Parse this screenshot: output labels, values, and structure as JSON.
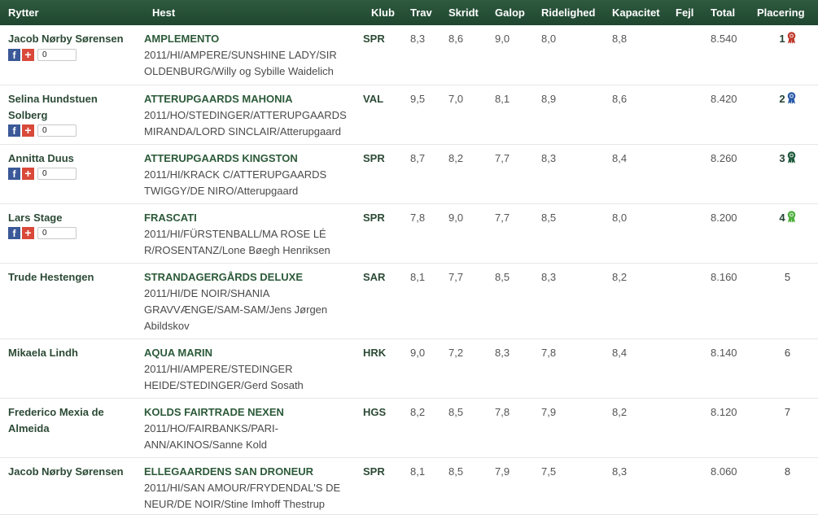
{
  "headers": {
    "rider": "Rytter",
    "horse": "Hest",
    "club": "Klub",
    "trav": "Trav",
    "skridt": "Skridt",
    "galop": "Galop",
    "ridelighed": "Ridelighed",
    "kapacitet": "Kapacitet",
    "fejl": "Fejl",
    "total": "Total",
    "placering": "Placering"
  },
  "rows": [
    {
      "rider": "Jacob Nørby Sørensen",
      "horse": "AMPLEMENTO",
      "info": "2011/HI/AMPERE/SUNSHINE LADY/SIR OLDENBURG/Willy og Sybille Waidelich",
      "club": "SPR",
      "trav": "8,3",
      "skridt": "8,6",
      "galop": "9,0",
      "ridelighed": "8,0",
      "kapacitet": "8,8",
      "fejl": "",
      "total": "8.540",
      "place": "1",
      "rosette_color": "#c0392b",
      "social": true,
      "share_count": "0",
      "rosette_icon": "rosette-red-icon"
    },
    {
      "rider": "Selina Hundstuen Solberg",
      "horse": "ATTERUPGAARDS MAHONIA",
      "info": "2011/HO/STEDINGER/ATTERUPGAARDS MIRANDA/LORD SINCLAIR/Atterupgaard",
      "club": "VAL",
      "trav": "9,5",
      "skridt": "7,0",
      "galop": "8,1",
      "ridelighed": "8,9",
      "kapacitet": "8,6",
      "fejl": "",
      "total": "8.420",
      "place": "2",
      "rosette_color": "#2a5aa8",
      "social": true,
      "share_count": "0",
      "rosette_icon": "rosette-blue-icon"
    },
    {
      "rider": "Annitta Duus",
      "horse": "ATTERUPGAARDS KINGSTON",
      "info": "2011/HI/KRACK C/ATTERUPGAARDS TWIGGY/DE NIRO/Atterupgaard",
      "club": "SPR",
      "trav": "8,7",
      "skridt": "8,2",
      "galop": "7,7",
      "ridelighed": "8,3",
      "kapacitet": "8,4",
      "fejl": "",
      "total": "8.260",
      "place": "3",
      "rosette_color": "#1f5a3c",
      "social": true,
      "share_count": "0",
      "rosette_icon": "rosette-darkgreen-icon"
    },
    {
      "rider": "Lars Stage",
      "horse": "FRASCATI",
      "info": "2011/HI/FÜRSTENBALL/MA ROSE LÉ R/ROSENTANZ/Lone Bøegh Henriksen",
      "club": "SPR",
      "trav": "7,8",
      "skridt": "9,0",
      "galop": "7,7",
      "ridelighed": "8,5",
      "kapacitet": "8,0",
      "fejl": "",
      "total": "8.200",
      "place": "4",
      "rosette_color": "#4caf3c",
      "social": true,
      "share_count": "0",
      "rosette_icon": "rosette-green-icon"
    },
    {
      "rider": "Trude Hestengen",
      "horse": "STRANDAGERGÅRDS DELUXE",
      "info": "2011/HI/DE NOIR/SHANIA GRAVVÆNGE/SAM-SAM/Jens Jørgen Abildskov",
      "club": "SAR",
      "trav": "8,1",
      "skridt": "7,7",
      "galop": "8,5",
      "ridelighed": "8,3",
      "kapacitet": "8,2",
      "fejl": "",
      "total": "8.160",
      "place": "5",
      "rosette_color": "",
      "social": false,
      "share_count": "",
      "rosette_icon": ""
    },
    {
      "rider": "Mikaela Lindh",
      "horse": "AQUA MARIN",
      "info": "2011/HI/AMPERE/STEDINGER HEIDE/STEDINGER/Gerd Sosath",
      "club": "HRK",
      "trav": "9,0",
      "skridt": "7,2",
      "galop": "8,3",
      "ridelighed": "7,8",
      "kapacitet": "8,4",
      "fejl": "",
      "total": "8.140",
      "place": "6",
      "rosette_color": "",
      "social": false,
      "share_count": "",
      "rosette_icon": ""
    },
    {
      "rider": "Frederico Mexia de Almeida",
      "horse": "KOLDS FAIRTRADE NEXEN",
      "info": "2011/HO/FAIRBANKS/PARI-ANN/AKINOS/Sanne Kold",
      "club": "HGS",
      "trav": "8,2",
      "skridt": "8,5",
      "galop": "7,8",
      "ridelighed": "7,9",
      "kapacitet": "8,2",
      "fejl": "",
      "total": "8.120",
      "place": "7",
      "rosette_color": "",
      "social": false,
      "share_count": "",
      "rosette_icon": ""
    },
    {
      "rider": "Jacob Nørby Sørensen",
      "horse": "ELLEGAARDENS SAN DRONEUR",
      "info": "2011/HI/SAN AMOUR/FRYDENDAL'S DE NEUR/DE NOIR/Stine Imhoff Thestrup",
      "club": "SPR",
      "trav": "8,1",
      "skridt": "8,5",
      "galop": "7,9",
      "ridelighed": "7,5",
      "kapacitet": "8,3",
      "fejl": "",
      "total": "8.060",
      "place": "8",
      "rosette_color": "",
      "social": false,
      "share_count": "",
      "rosette_icon": ""
    }
  ]
}
